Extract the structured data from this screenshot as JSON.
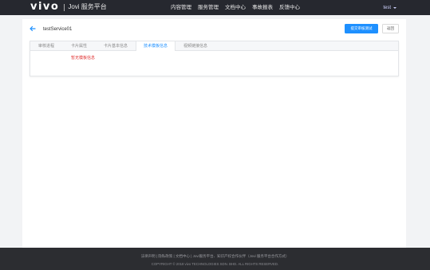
{
  "brand": {
    "logo_text": "vivo",
    "platform_name": "Jovi 服务平台"
  },
  "nav": [
    {
      "label": "内容管理"
    },
    {
      "label": "服务管理"
    },
    {
      "label": "文档中心"
    },
    {
      "label": "事故报表"
    },
    {
      "label": "反馈中心"
    }
  ],
  "user": {
    "name": "test"
  },
  "page": {
    "title": "testService01",
    "primary_button": "提交审核测试",
    "secondary_button": "返回"
  },
  "tabs": [
    {
      "label": "审核进程"
    },
    {
      "label": "卡片属性"
    },
    {
      "label": "卡片基本信息"
    },
    {
      "label": "技术模板信息"
    },
    {
      "label": "视频链接信息"
    }
  ],
  "active_tab_index": 3,
  "warning": "暂无模板信息",
  "footer": {
    "links": "法律声明  |  隐私政策  |  文档中心  |  Jovi服务平台、知识产权合作伙伴（Jovi 服务平台合作方式）",
    "copyright": "COPYRIGHT © 2018 vivo TECHNOLOGIES SDN. BHD. ALL RIGHTS RESERVED."
  },
  "colors": {
    "accent": "#1e90ff",
    "topbar": "#26282f",
    "footer": "#2c2d31",
    "warning": "#e03131"
  }
}
